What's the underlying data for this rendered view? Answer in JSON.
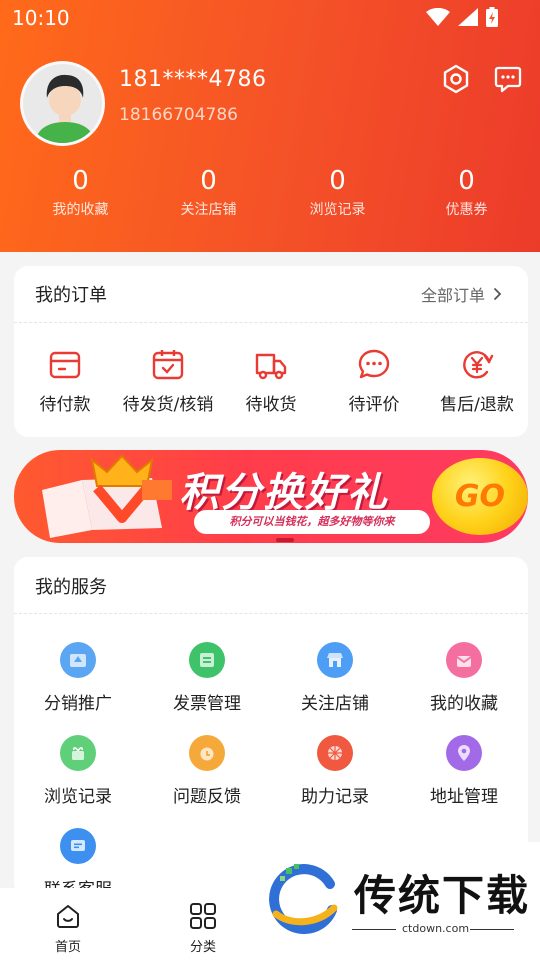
{
  "status": {
    "time": "10:10"
  },
  "user": {
    "name": "181****4786",
    "phone": "18166704786"
  },
  "stats": [
    {
      "value": "0",
      "label": "我的收藏"
    },
    {
      "value": "0",
      "label": "关注店铺"
    },
    {
      "value": "0",
      "label": "浏览记录"
    },
    {
      "value": "0",
      "label": "优惠券"
    }
  ],
  "orders": {
    "title": "我的订单",
    "all_link": "全部订单",
    "items": [
      {
        "label": "待付款",
        "icon": "wallet-icon"
      },
      {
        "label": "待发货/核销",
        "icon": "calendar-check-icon"
      },
      {
        "label": "待收货",
        "icon": "truck-icon"
      },
      {
        "label": "待评价",
        "icon": "chat-bubble-icon"
      },
      {
        "label": "售后/退款",
        "icon": "refund-icon"
      }
    ]
  },
  "banner": {
    "title": "积分换好礼",
    "subtitle": "积分可以当钱花，超多好物等你来",
    "go": "GO"
  },
  "services": {
    "title": "我的服务",
    "items": [
      {
        "label": "分销推广",
        "icon": "distribution-icon",
        "color": "#5aa6f2"
      },
      {
        "label": "发票管理",
        "icon": "invoice-icon",
        "color": "#3ec26a"
      },
      {
        "label": "关注店铺",
        "icon": "store-icon",
        "color": "#4f9ef5"
      },
      {
        "label": "我的收藏",
        "icon": "favorite-icon",
        "color": "#f56ea0"
      },
      {
        "label": "浏览记录",
        "icon": "history-icon",
        "color": "#5fcf7a"
      },
      {
        "label": "问题反馈",
        "icon": "feedback-icon",
        "color": "#f4a93a"
      },
      {
        "label": "助力记录",
        "icon": "assist-icon",
        "color": "#f0593f"
      },
      {
        "label": "地址管理",
        "icon": "location-icon",
        "color": "#a36ae8"
      },
      {
        "label": "联系客服",
        "icon": "customer-service-icon",
        "color": "#3d8ff0"
      }
    ]
  },
  "tabbar": [
    {
      "label": "首页",
      "icon": "home-icon"
    },
    {
      "label": "分类",
      "icon": "category-icon"
    }
  ],
  "watermark": {
    "text": "传统下载",
    "url": "ctdown.com"
  }
}
